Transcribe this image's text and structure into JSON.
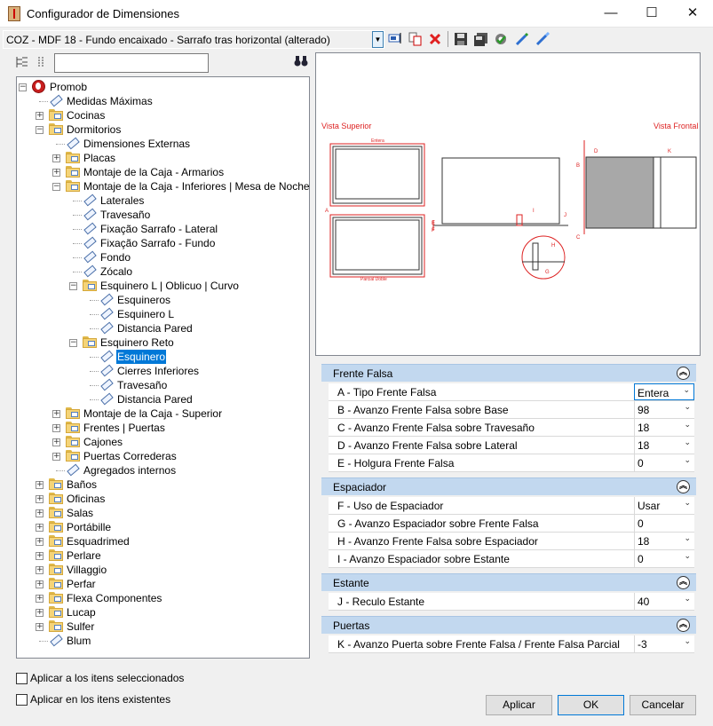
{
  "window": {
    "title": "Configurador de Dimensiones",
    "minimize": "—",
    "maximize": "☐",
    "close": "✕"
  },
  "toolbar": {
    "combo_value": "COZ - MDF 18 - Fundo encaixado - Sarrafo tras horizontal (alterado)",
    "combo_arrow": "▼"
  },
  "search": {
    "value": "",
    "placeholder": ""
  },
  "search_icon": "🔍",
  "tree": [
    {
      "label": "Promob",
      "level": 0,
      "icon": "root",
      "exp": "−"
    },
    {
      "label": "Medidas Máximas",
      "level": 1,
      "icon": "tag"
    },
    {
      "label": "Cocinas",
      "level": 1,
      "icon": "folder",
      "exp": "+"
    },
    {
      "label": "Dormitorios",
      "level": 1,
      "icon": "folder",
      "exp": "−"
    },
    {
      "label": "Dimensiones Externas",
      "level": 2,
      "icon": "tag"
    },
    {
      "label": "Placas",
      "level": 2,
      "icon": "folder",
      "exp": "+"
    },
    {
      "label": "Montaje de la Caja - Armarios",
      "level": 2,
      "icon": "folder",
      "exp": "+"
    },
    {
      "label": "Montaje de la Caja - Inferiores | Mesa de Noche",
      "level": 2,
      "icon": "folder",
      "exp": "−"
    },
    {
      "label": "Laterales",
      "level": 3,
      "icon": "tag"
    },
    {
      "label": "Travesaño",
      "level": 3,
      "icon": "tag"
    },
    {
      "label": "Fixação Sarrafo - Lateral",
      "level": 3,
      "icon": "tag"
    },
    {
      "label": "Fixação Sarrafo - Fundo",
      "level": 3,
      "icon": "tag"
    },
    {
      "label": "Fondo",
      "level": 3,
      "icon": "tag"
    },
    {
      "label": "Zócalo",
      "level": 3,
      "icon": "tag"
    },
    {
      "label": "Esquinero L | Oblicuo | Curvo",
      "level": 3,
      "icon": "folder",
      "exp": "−"
    },
    {
      "label": "Esquineros",
      "level": 4,
      "icon": "tag"
    },
    {
      "label": "Esquinero L",
      "level": 4,
      "icon": "tag"
    },
    {
      "label": "Distancia Pared",
      "level": 4,
      "icon": "tag"
    },
    {
      "label": "Esquinero Reto",
      "level": 3,
      "icon": "folder",
      "exp": "−"
    },
    {
      "label": "Esquinero",
      "level": 4,
      "icon": "tag",
      "selected": true
    },
    {
      "label": "Cierres Inferiores",
      "level": 4,
      "icon": "tag"
    },
    {
      "label": "Travesaño",
      "level": 4,
      "icon": "tag"
    },
    {
      "label": "Distancia Pared",
      "level": 4,
      "icon": "tag"
    },
    {
      "label": "Montaje de la Caja - Superior",
      "level": 2,
      "icon": "folder",
      "exp": "+"
    },
    {
      "label": "Frentes | Puertas",
      "level": 2,
      "icon": "folder",
      "exp": "+"
    },
    {
      "label": "Cajones",
      "level": 2,
      "icon": "folder",
      "exp": "+"
    },
    {
      "label": "Puertas Correderas",
      "level": 2,
      "icon": "folder",
      "exp": "+"
    },
    {
      "label": "Agregados internos",
      "level": 2,
      "icon": "tag"
    },
    {
      "label": "Baños",
      "level": 1,
      "icon": "folder",
      "exp": "+"
    },
    {
      "label": "Oficinas",
      "level": 1,
      "icon": "folder",
      "exp": "+"
    },
    {
      "label": "Salas",
      "level": 1,
      "icon": "folder",
      "exp": "+"
    },
    {
      "label": "Portábille",
      "level": 1,
      "icon": "folder",
      "exp": "+"
    },
    {
      "label": "Esquadrimed",
      "level": 1,
      "icon": "folder",
      "exp": "+"
    },
    {
      "label": "Perlare",
      "level": 1,
      "icon": "folder",
      "exp": "+"
    },
    {
      "label": "Villaggio",
      "level": 1,
      "icon": "folder",
      "exp": "+"
    },
    {
      "label": "Perfar",
      "level": 1,
      "icon": "folder",
      "exp": "+"
    },
    {
      "label": "Flexa Componentes",
      "level": 1,
      "icon": "folder",
      "exp": "+"
    },
    {
      "label": "Lucap",
      "level": 1,
      "icon": "folder",
      "exp": "+"
    },
    {
      "label": "Sulfer",
      "level": 1,
      "icon": "folder",
      "exp": "+"
    },
    {
      "label": "Blum",
      "level": 1,
      "icon": "tag"
    }
  ],
  "preview": {
    "vista_superior": "Vista Superior",
    "vista_frontal": "Vista Frontal",
    "entera": "Entera",
    "parcial_doble": "Parcial Doble",
    "letters": {
      "A": "A",
      "B": "B",
      "C": "C",
      "D": "D",
      "E": "E",
      "F": "F",
      "G": "G",
      "H": "H",
      "I": "I",
      "J": "J",
      "K": "K"
    }
  },
  "sections": [
    {
      "title": "Frente Falsa",
      "rows": [
        {
          "label": "A - Tipo Frente Falsa",
          "value": "Entera",
          "dropdown": true
        },
        {
          "label": "B - Avanzo Frente Falsa sobre Base",
          "value": "98",
          "dropdown": true
        },
        {
          "label": "C - Avanzo Frente Falsa sobre Travesaño",
          "value": "18",
          "dropdown": true
        },
        {
          "label": "D - Avanzo Frente Falsa sobre Lateral",
          "value": "18",
          "dropdown": true
        },
        {
          "label": "E - Holgura Frente Falsa",
          "value": "0",
          "dropdown": true
        }
      ]
    },
    {
      "title": "Espaciador",
      "rows": [
        {
          "label": "F - Uso de Espaciador",
          "value": "Usar",
          "dropdown": true
        },
        {
          "label": "G - Avanzo Espaciador sobre Frente Falsa",
          "value": "0",
          "dropdown": false
        },
        {
          "label": "H - Avanzo Frente Falsa sobre Espaciador",
          "value": "18",
          "dropdown": true
        },
        {
          "label": "I - Avanzo Espaciador sobre Estante",
          "value": "0",
          "dropdown": true
        }
      ]
    },
    {
      "title": "Estante",
      "rows": [
        {
          "label": "J - Reculo Estante",
          "value": "40",
          "dropdown": true
        }
      ]
    },
    {
      "title": "Puertas",
      "rows": [
        {
          "label": "K - Avanzo Puerta sobre Frente Falsa / Frente Falsa Parcial",
          "value": "-3",
          "dropdown": true
        }
      ]
    }
  ],
  "collapse_glyph": "︽",
  "dropdown_glyph": "⌄",
  "checks": {
    "apply_selected": "Aplicar a los itens seleccionados",
    "apply_existing": "Aplicar en los itens existentes"
  },
  "buttons": {
    "apply": "Aplicar",
    "ok": "OK",
    "cancel": "Cancelar"
  }
}
